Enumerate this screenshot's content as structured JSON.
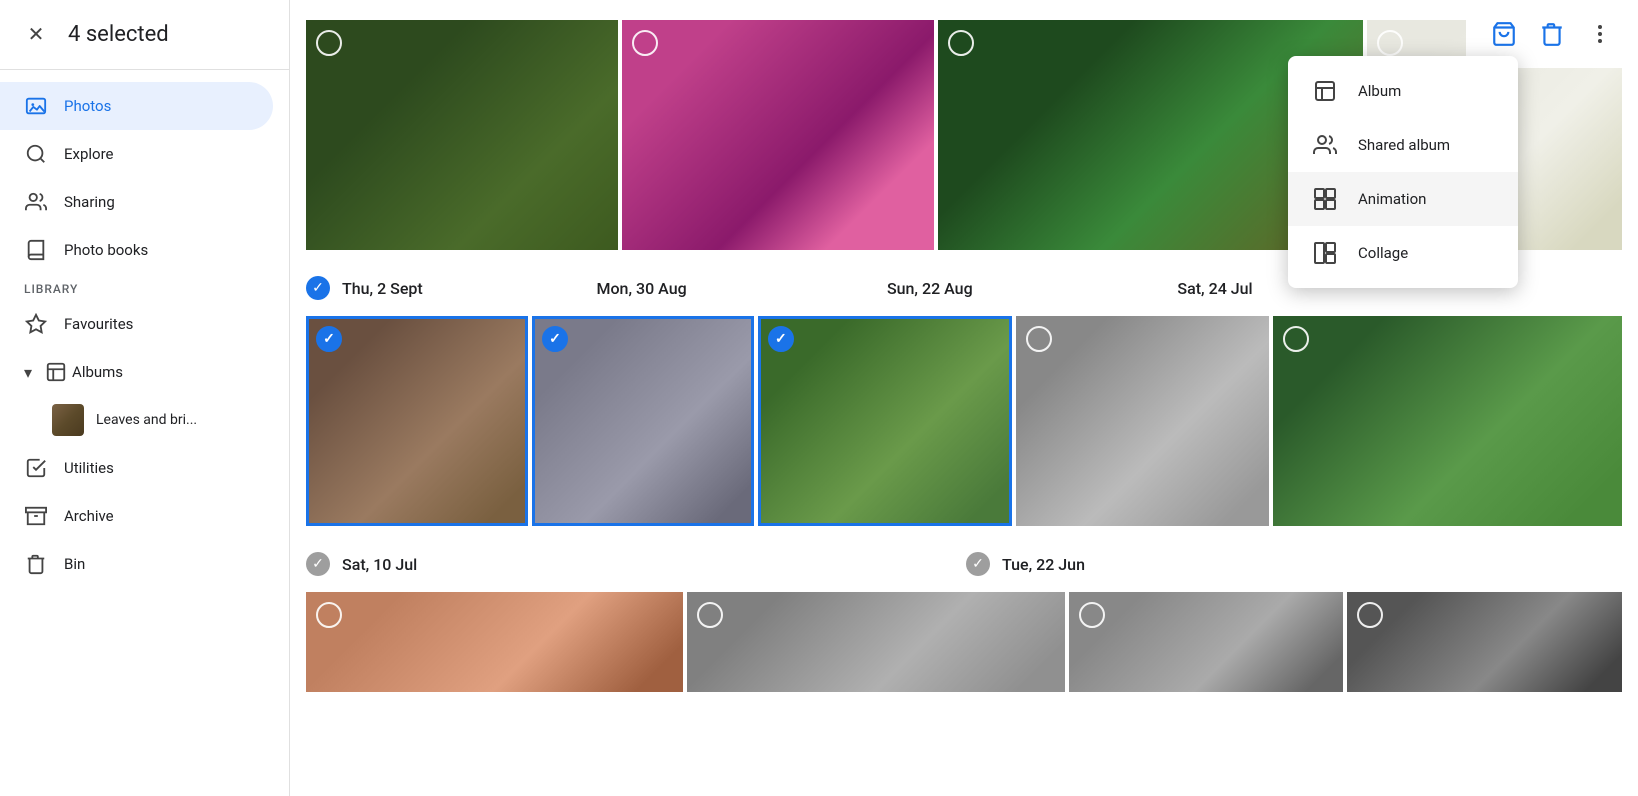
{
  "header": {
    "selected_count": "4 selected",
    "close_label": "×"
  },
  "sidebar": {
    "nav_items": [
      {
        "id": "photos",
        "label": "Photos",
        "icon": "🖼",
        "active": true
      },
      {
        "id": "explore",
        "label": "Explore",
        "icon": "🔍",
        "active": false
      },
      {
        "id": "sharing",
        "label": "Sharing",
        "icon": "👥",
        "active": false
      },
      {
        "id": "photo_books",
        "label": "Photo books",
        "icon": "📖",
        "active": false
      }
    ],
    "library_label": "LIBRARY",
    "library_items": [
      {
        "id": "favourites",
        "label": "Favourites",
        "icon": "⭐"
      },
      {
        "id": "albums",
        "label": "Albums",
        "icon": "📔"
      },
      {
        "id": "utilities",
        "label": "Utilities",
        "icon": "✅"
      },
      {
        "id": "archive",
        "label": "Archive",
        "icon": "📥"
      },
      {
        "id": "bin",
        "label": "Bin",
        "icon": "🗑"
      }
    ],
    "album_name": "Leaves and bri..."
  },
  "dropdown": {
    "items": [
      {
        "id": "album",
        "label": "Album",
        "icon": "album"
      },
      {
        "id": "shared_album",
        "label": "Shared album",
        "icon": "shared"
      },
      {
        "id": "animation",
        "label": "Animation",
        "icon": "animation"
      },
      {
        "id": "collage",
        "label": "Collage",
        "icon": "collage"
      }
    ]
  },
  "grid": {
    "date_sections": [
      {
        "date": "Thu, 2 Sept",
        "checked": true,
        "photos": [
          {
            "id": "p1",
            "selected": false,
            "color": "p1"
          }
        ]
      },
      {
        "date": "Mon, 30 Aug",
        "checked": false,
        "photos": [
          {
            "id": "p2",
            "selected": false,
            "color": "p2"
          }
        ]
      },
      {
        "date": "Sun, 22 Aug",
        "checked": false,
        "photos": [
          {
            "id": "p3",
            "selected": false,
            "color": "p3"
          }
        ]
      },
      {
        "date": "Sat, 24 Jul",
        "checked": false,
        "photos": [
          {
            "id": "p4",
            "selected": false,
            "color": "p4"
          }
        ]
      }
    ],
    "row2_sections": [
      {
        "date": "Thu, 2 Sept",
        "checked": true,
        "photos": [
          {
            "id": "p9",
            "selected": true,
            "color": "p9"
          },
          {
            "id": "p10",
            "selected": true,
            "color": "p10"
          }
        ]
      },
      {
        "date": "Mon, 30 Aug",
        "checked": true,
        "photos": [
          {
            "id": "p11",
            "selected": true,
            "color": "p11"
          }
        ]
      },
      {
        "date": "Sun, 22 Aug",
        "photos": [
          {
            "id": "p5",
            "selected": false,
            "color": "p5"
          }
        ]
      },
      {
        "date": "Sat, 24 Jul",
        "photos": [
          {
            "id": "p6",
            "selected": false,
            "color": "p6"
          }
        ]
      }
    ],
    "row3_dates": [
      {
        "date": "Sat, 10 Jul",
        "checked": true
      },
      {
        "date": "Tue, 22 Jun",
        "checked": true
      }
    ],
    "row3_photos": [
      {
        "id": "p12",
        "selected": false,
        "color": "p7"
      },
      {
        "id": "p13",
        "selected": false,
        "color": "p8"
      },
      {
        "id": "p14",
        "selected": false,
        "color": "p12"
      },
      {
        "id": "p15",
        "selected": false,
        "color": "p13"
      }
    ]
  }
}
